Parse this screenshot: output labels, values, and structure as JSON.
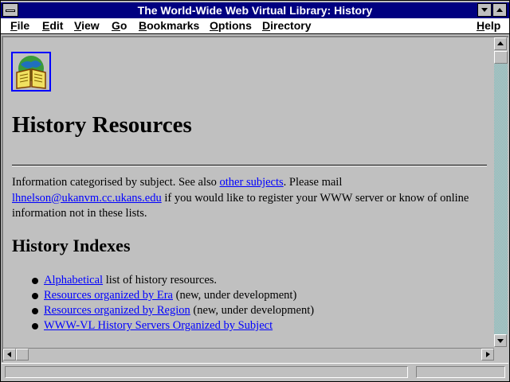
{
  "window": {
    "title": "The World-Wide Web Virtual Library: History"
  },
  "menu": {
    "items": [
      {
        "label": "File",
        "u": "F",
        "rest": "ile"
      },
      {
        "label": "Edit",
        "u": "E",
        "rest": "dit"
      },
      {
        "label": "View",
        "u": "V",
        "rest": "iew"
      },
      {
        "label": "Go",
        "u": "G",
        "rest": "o"
      },
      {
        "label": "Bookmarks",
        "u": "B",
        "rest": "ookmarks"
      },
      {
        "label": "Options",
        "u": "O",
        "rest": "ptions"
      },
      {
        "label": "Directory",
        "u": "D",
        "rest": "irectory"
      },
      {
        "label": "Help",
        "u": "H",
        "rest": "elp"
      }
    ]
  },
  "page": {
    "heading": "History Resources",
    "intro": {
      "text1": "Information categorised by subject. See also ",
      "link1": "other subjects",
      "text2": ". Please mail ",
      "email": "lhnelson@ukanvm.cc.ukans.edu",
      "text3": " if you would like to register your WWW server or know of online information not in these lists."
    },
    "subheading": "History Indexes",
    "list": [
      {
        "link": "Alphabetical",
        "after": " list of history resources."
      },
      {
        "link": "Resources organized by Era",
        "after": " (new, under development)"
      },
      {
        "link": "Resources organized by Region",
        "after": " (new, under development)"
      },
      {
        "link": "WWW-VL History Servers Organized by Subject",
        "after": ""
      }
    ]
  },
  "icons": {
    "logo": "globe-book-icon",
    "sysmenu": "system-menu-icon",
    "minimize": "minimize-arrow-icon",
    "maximize": "maximize-arrow-icon"
  },
  "colors": {
    "titlebar": "#000080",
    "link": "#0000ff",
    "background": "#c0c0c0"
  }
}
